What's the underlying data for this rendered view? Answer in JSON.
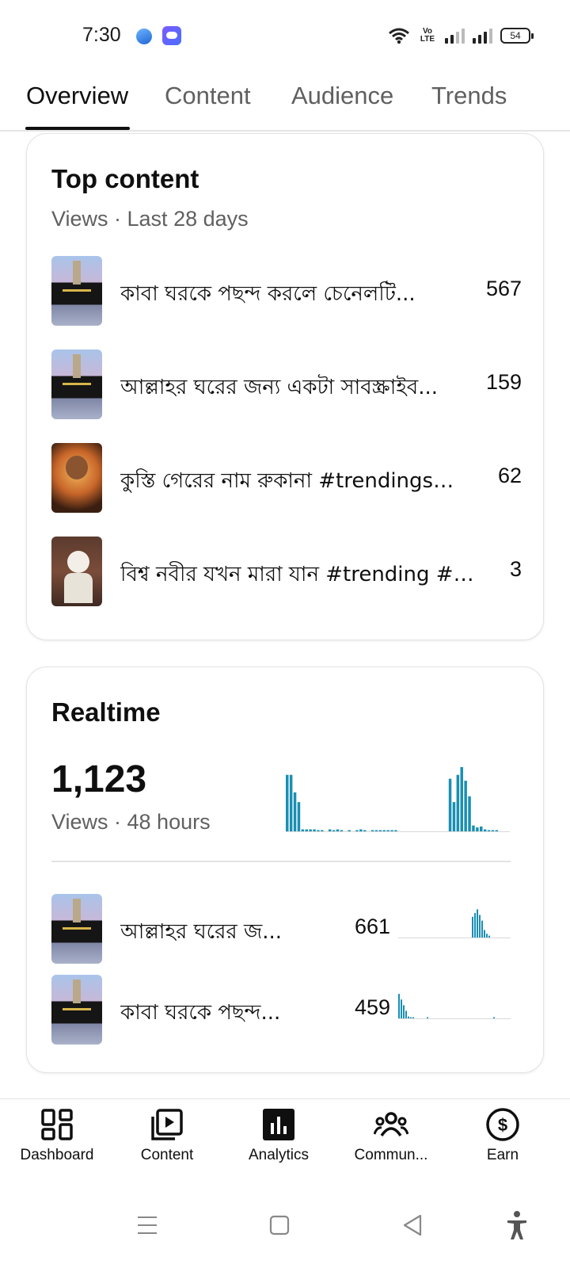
{
  "status_bar": {
    "time": "7:30",
    "network_label": "Vo LTE",
    "battery": "54",
    "icons": [
      "browser-app-icon",
      "weather-app-icon",
      "wifi-icon",
      "signal-icon",
      "battery-icon"
    ]
  },
  "tabs": [
    {
      "label": "Overview",
      "active": true
    },
    {
      "label": "Content",
      "active": false
    },
    {
      "label": "Audience",
      "active": false
    },
    {
      "label": "Trends",
      "active": false
    }
  ],
  "top_content": {
    "title": "Top content",
    "subtitle": "Views · Last 28 days",
    "items": [
      {
        "title": "কাবা ঘরকে পছন্দ করলে চেনেলটি...",
        "views": "567",
        "thumb": "kaaba"
      },
      {
        "title": "আল্লাহর ঘরের জন্য একটা সাবস্ক্রাইব...",
        "views": "159",
        "thumb": "kaaba"
      },
      {
        "title": "কুস্তি গেরের নাম রুকানা #trendingsh...",
        "views": "62",
        "thumb": "wrestler"
      },
      {
        "title": "বিশ্ব নবীর যখন মারা যান #trending #t...",
        "views": "3",
        "thumb": "speaker"
      }
    ]
  },
  "realtime": {
    "title": "Realtime",
    "total_views": "1,123",
    "subtitle": "Views · 48 hours",
    "accent_color": "#1a8fb3",
    "chart_data": {
      "type": "bar",
      "series": [
        {
          "values": [
            58,
            58,
            40,
            30,
            2,
            2,
            2,
            2,
            1,
            1,
            0,
            2,
            1,
            2,
            1,
            0,
            1,
            0,
            1,
            2,
            1,
            0,
            1,
            1,
            1,
            1,
            1,
            1,
            1,
            0,
            0,
            0,
            0,
            0,
            0,
            0,
            0,
            0,
            0,
            0,
            0,
            0,
            54,
            30,
            58,
            66,
            52,
            36,
            6,
            4,
            5,
            2,
            1,
            1,
            1,
            0,
            0
          ]
        }
      ]
    },
    "items": [
      {
        "title": "আল্লাহর ঘরের জ...",
        "views": "661",
        "thumb": "kaaba",
        "chart_data": {
          "type": "bar",
          "values": [
            0,
            0,
            0,
            0,
            0,
            0,
            0,
            0,
            0,
            0,
            0,
            0,
            0,
            0,
            0,
            0,
            0,
            0,
            0,
            0,
            0,
            0,
            0,
            0,
            0,
            0,
            0,
            0,
            0,
            0,
            0,
            22,
            26,
            30,
            24,
            18,
            8,
            4,
            2,
            0,
            0,
            0,
            0,
            0,
            0,
            0,
            0
          ]
        }
      },
      {
        "title": "কাবা ঘরকে পছন্দ...",
        "views": "459",
        "thumb": "kaaba",
        "chart_data": {
          "type": "bar",
          "values": [
            26,
            20,
            14,
            8,
            2,
            1,
            1,
            0,
            0,
            0,
            0,
            0,
            1,
            0,
            0,
            0,
            0,
            0,
            0,
            0,
            0,
            0,
            0,
            0,
            0,
            0,
            0,
            0,
            0,
            0,
            0,
            0,
            0,
            0,
            0,
            0,
            0,
            0,
            0,
            0,
            1,
            0,
            0,
            0,
            0,
            0,
            0
          ]
        }
      }
    ]
  },
  "bottom_nav": [
    {
      "label": "Dashboard",
      "icon": "dashboard-icon",
      "active": false
    },
    {
      "label": "Content",
      "icon": "content-icon",
      "active": false
    },
    {
      "label": "Analytics",
      "icon": "analytics-icon",
      "active": true
    },
    {
      "label": "Commun...",
      "icon": "community-icon",
      "active": false
    },
    {
      "label": "Earn",
      "icon": "earn-icon",
      "active": false
    }
  ],
  "system_nav": [
    "menu-icon",
    "home-icon",
    "back-icon",
    "accessibility-icon"
  ]
}
